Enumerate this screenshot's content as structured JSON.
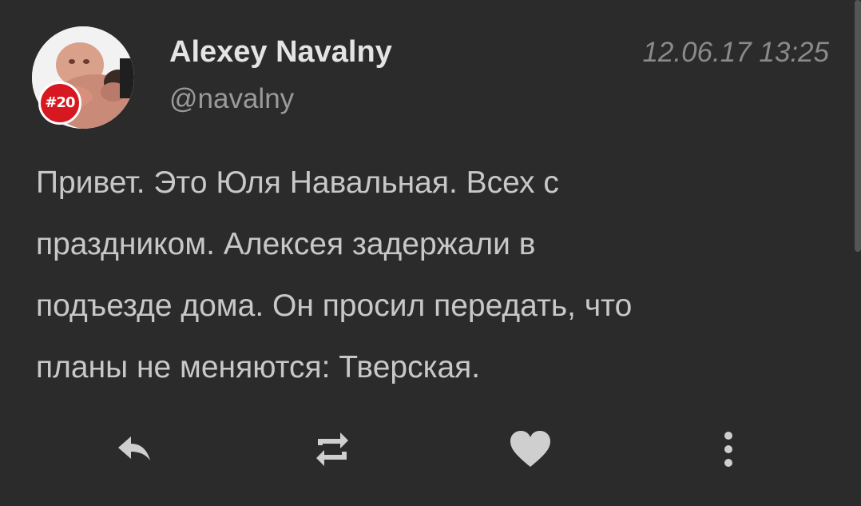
{
  "tweet": {
    "author": {
      "display_name": "Alexey Navalny",
      "handle": "@navalny",
      "avatar_badge": "#20",
      "avatar_icon": "avatar-photo-icon"
    },
    "timestamp": "12.06.17 13:25",
    "text_lines": [
      "Привет. Это Юля Навальная. Всех с",
      "праздником. Алексея задержали в",
      "подъезде дома. Он просил передать, что",
      "планы не меняются: Тверская."
    ],
    "actions": [
      {
        "name": "reply",
        "icon": "reply-icon"
      },
      {
        "name": "retweet",
        "icon": "retweet-icon"
      },
      {
        "name": "like",
        "icon": "heart-icon"
      },
      {
        "name": "more",
        "icon": "more-vertical-icon"
      }
    ]
  },
  "colors": {
    "background": "#2b2b2b",
    "name": "#e4e4e4",
    "text": "#c8c8c8",
    "muted": "#9a9a9a",
    "icons": "#cfcfcf",
    "badge": "#d81820"
  }
}
